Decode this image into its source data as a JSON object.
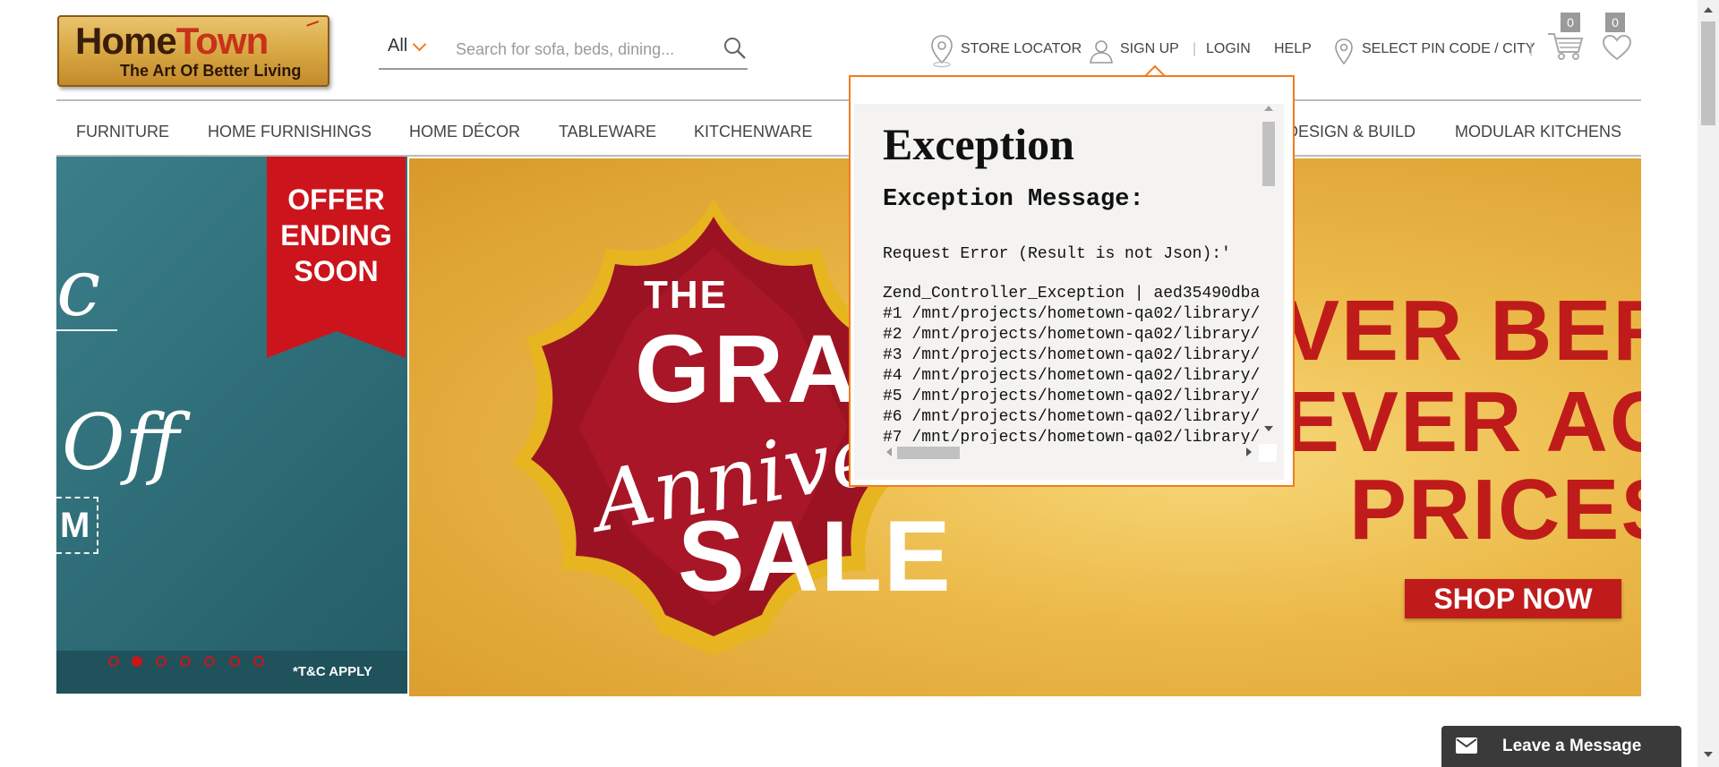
{
  "header": {
    "logo": {
      "word1": "Home",
      "word2": "Town",
      "tagline": "The Art Of Better Living"
    },
    "search": {
      "category": "All",
      "placeholder": "Search for sofa, beds, dining..."
    },
    "links": {
      "store_locator": "STORE LOCATOR",
      "sign_up": "SIGN UP",
      "login": "LOGIN",
      "help": "HELP",
      "pincode": "SELECT PIN CODE / CITY"
    },
    "cart_count": "0",
    "wishlist_count": "0",
    "separator": "|"
  },
  "nav": {
    "items": [
      "FURNITURE",
      "HOME FURNISHINGS",
      "HOME DÉCOR",
      "TABLEWARE",
      "KITCHENWARE",
      "DESIGN & BUILD",
      "MODULAR KITCHENS"
    ]
  },
  "hero_left": {
    "script_text": "c",
    "off_text": "Off",
    "code_text": "M",
    "offer_lines": [
      "OFFER",
      "ENDING",
      "SOON"
    ],
    "tnc": "*T&C APPLY",
    "slide_count": 7,
    "active_slide": 2
  },
  "hero_right": {
    "the": "THE",
    "grand": "GRA",
    "anniversary": "Anniver",
    "sale": "SALE",
    "line1": "VER BEF",
    "line2": "EVER AGA",
    "line3": "PRICES",
    "shop_now": "SHOP NOW"
  },
  "exception": {
    "title": "Exception",
    "message_heading": "Exception Message:",
    "request_error": "Request Error (Result is not Json):'",
    "trace_head": "Zend_Controller_Exception | aed35490dba",
    "trace_lines": [
      "#1 /mnt/projects/hometown-qa02/library/",
      "#2 /mnt/projects/hometown-qa02/library/",
      "#3 /mnt/projects/hometown-qa02/library/",
      "#4 /mnt/projects/hometown-qa02/library/",
      "#5 /mnt/projects/hometown-qa02/library/",
      "#6 /mnt/projects/hometown-qa02/library/",
      "#7 /mnt/projects/hometown-qa02/library/"
    ]
  },
  "chat": {
    "label": "Leave a Message"
  },
  "colors": {
    "accent_orange": "#f07c1e",
    "brand_red": "#cc141c",
    "hero_teal": "#2c6a74",
    "hero_gold": "#ecba4a",
    "chat_bg": "#3a3a3a"
  }
}
